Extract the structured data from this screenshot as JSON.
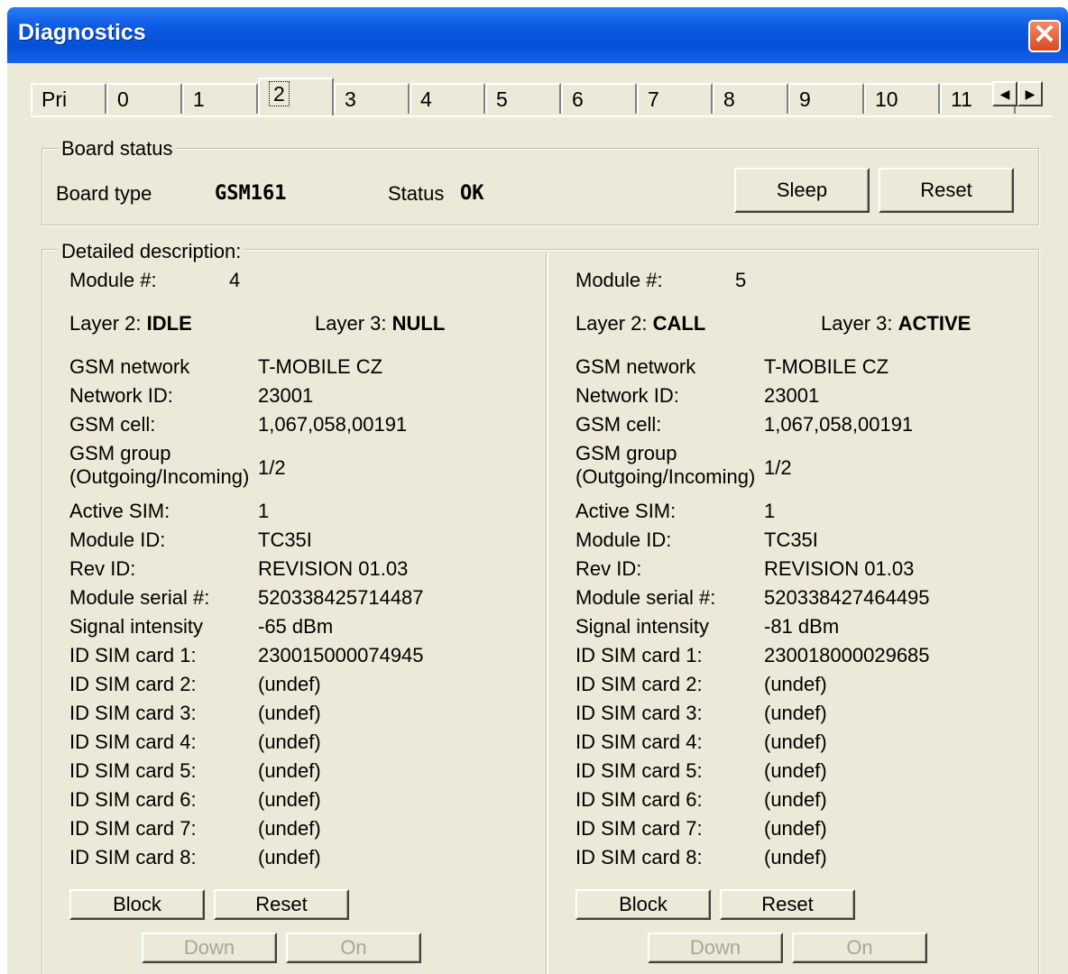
{
  "window": {
    "title": "Diagnostics"
  },
  "tabs": [
    "Pri",
    "0",
    "1",
    "2",
    "3",
    "4",
    "5",
    "6",
    "7",
    "8",
    "9",
    "10",
    "11"
  ],
  "active_tab": "2",
  "board_status": {
    "group_label": "Board status",
    "board_type_label": "Board type",
    "board_type_value": "GSM161",
    "status_label": "Status",
    "status_value": "OK",
    "sleep_button": "Sleep",
    "reset_button": "Reset"
  },
  "detailed": {
    "group_label": "Detailed description:",
    "modules": [
      {
        "module_label": "Module #:",
        "module_value": "4",
        "layer2_label": "Layer 2:",
        "layer2_value": "IDLE",
        "layer3_label": "Layer 3:",
        "layer3_value": "NULL",
        "gsm_network_label": "GSM network",
        "gsm_network": "T-MOBILE CZ",
        "network_id_label": "Network ID:",
        "network_id": "23001",
        "gsm_cell_label": "GSM cell:",
        "gsm_cell": "1,067,058,00191",
        "gsm_group_label_1": "GSM group",
        "gsm_group_label_2": "(Outgoing/Incoming)",
        "gsm_group": "1/2",
        "active_sim_label": "Active SIM:",
        "active_sim": "1",
        "module_id_label": "Module ID:",
        "module_id": "TC35I",
        "rev_id_label": "Rev ID:",
        "rev_id": "REVISION 01.03",
        "serial_label": "Module serial #:",
        "serial": "520338425714487",
        "signal_label": "Signal intensity",
        "signal": "-65 dBm",
        "sim_cards": [
          {
            "label": "ID SIM card 1:",
            "value": "230015000074945"
          },
          {
            "label": "ID SIM card 2:",
            "value": "(undef)"
          },
          {
            "label": "ID SIM card 3:",
            "value": "(undef)"
          },
          {
            "label": "ID SIM card 4:",
            "value": "(undef)"
          },
          {
            "label": "ID SIM card 5:",
            "value": "(undef)"
          },
          {
            "label": "ID SIM card 6:",
            "value": "(undef)"
          },
          {
            "label": "ID SIM card 7:",
            "value": "(undef)"
          },
          {
            "label": "ID SIM card 8:",
            "value": "(undef)"
          }
        ],
        "block_button": "Block",
        "reset_button": "Reset",
        "down_button": "Down",
        "on_button": "On"
      },
      {
        "module_label": "Module #:",
        "module_value": "5",
        "layer2_label": "Layer 2:",
        "layer2_value": "CALL",
        "layer3_label": "Layer 3:",
        "layer3_value": "ACTIVE",
        "gsm_network_label": "GSM network",
        "gsm_network": "T-MOBILE CZ",
        "network_id_label": "Network ID:",
        "network_id": "23001",
        "gsm_cell_label": "GSM cell:",
        "gsm_cell": "1,067,058,00191",
        "gsm_group_label_1": "GSM group",
        "gsm_group_label_2": "(Outgoing/Incoming)",
        "gsm_group": "1/2",
        "active_sim_label": "Active SIM:",
        "active_sim": "1",
        "module_id_label": "Module ID:",
        "module_id": "TC35I",
        "rev_id_label": "Rev ID:",
        "rev_id": "REVISION 01.03",
        "serial_label": "Module serial #:",
        "serial": "520338427464495",
        "signal_label": "Signal intensity",
        "signal": "-81 dBm",
        "sim_cards": [
          {
            "label": "ID SIM card 1:",
            "value": "230018000029685"
          },
          {
            "label": "ID SIM card 2:",
            "value": "(undef)"
          },
          {
            "label": "ID SIM card 3:",
            "value": "(undef)"
          },
          {
            "label": "ID SIM card 4:",
            "value": "(undef)"
          },
          {
            "label": "ID SIM card 5:",
            "value": "(undef)"
          },
          {
            "label": "ID SIM card 6:",
            "value": "(undef)"
          },
          {
            "label": "ID SIM card 7:",
            "value": "(undef)"
          },
          {
            "label": "ID SIM card 8:",
            "value": "(undef)"
          }
        ],
        "block_button": "Block",
        "reset_button": "Reset",
        "down_button": "Down",
        "on_button": "On"
      }
    ]
  },
  "icons": {
    "close": "close-icon",
    "scroll_left": "arrow-left-icon",
    "scroll_right": "arrow-right-icon"
  }
}
